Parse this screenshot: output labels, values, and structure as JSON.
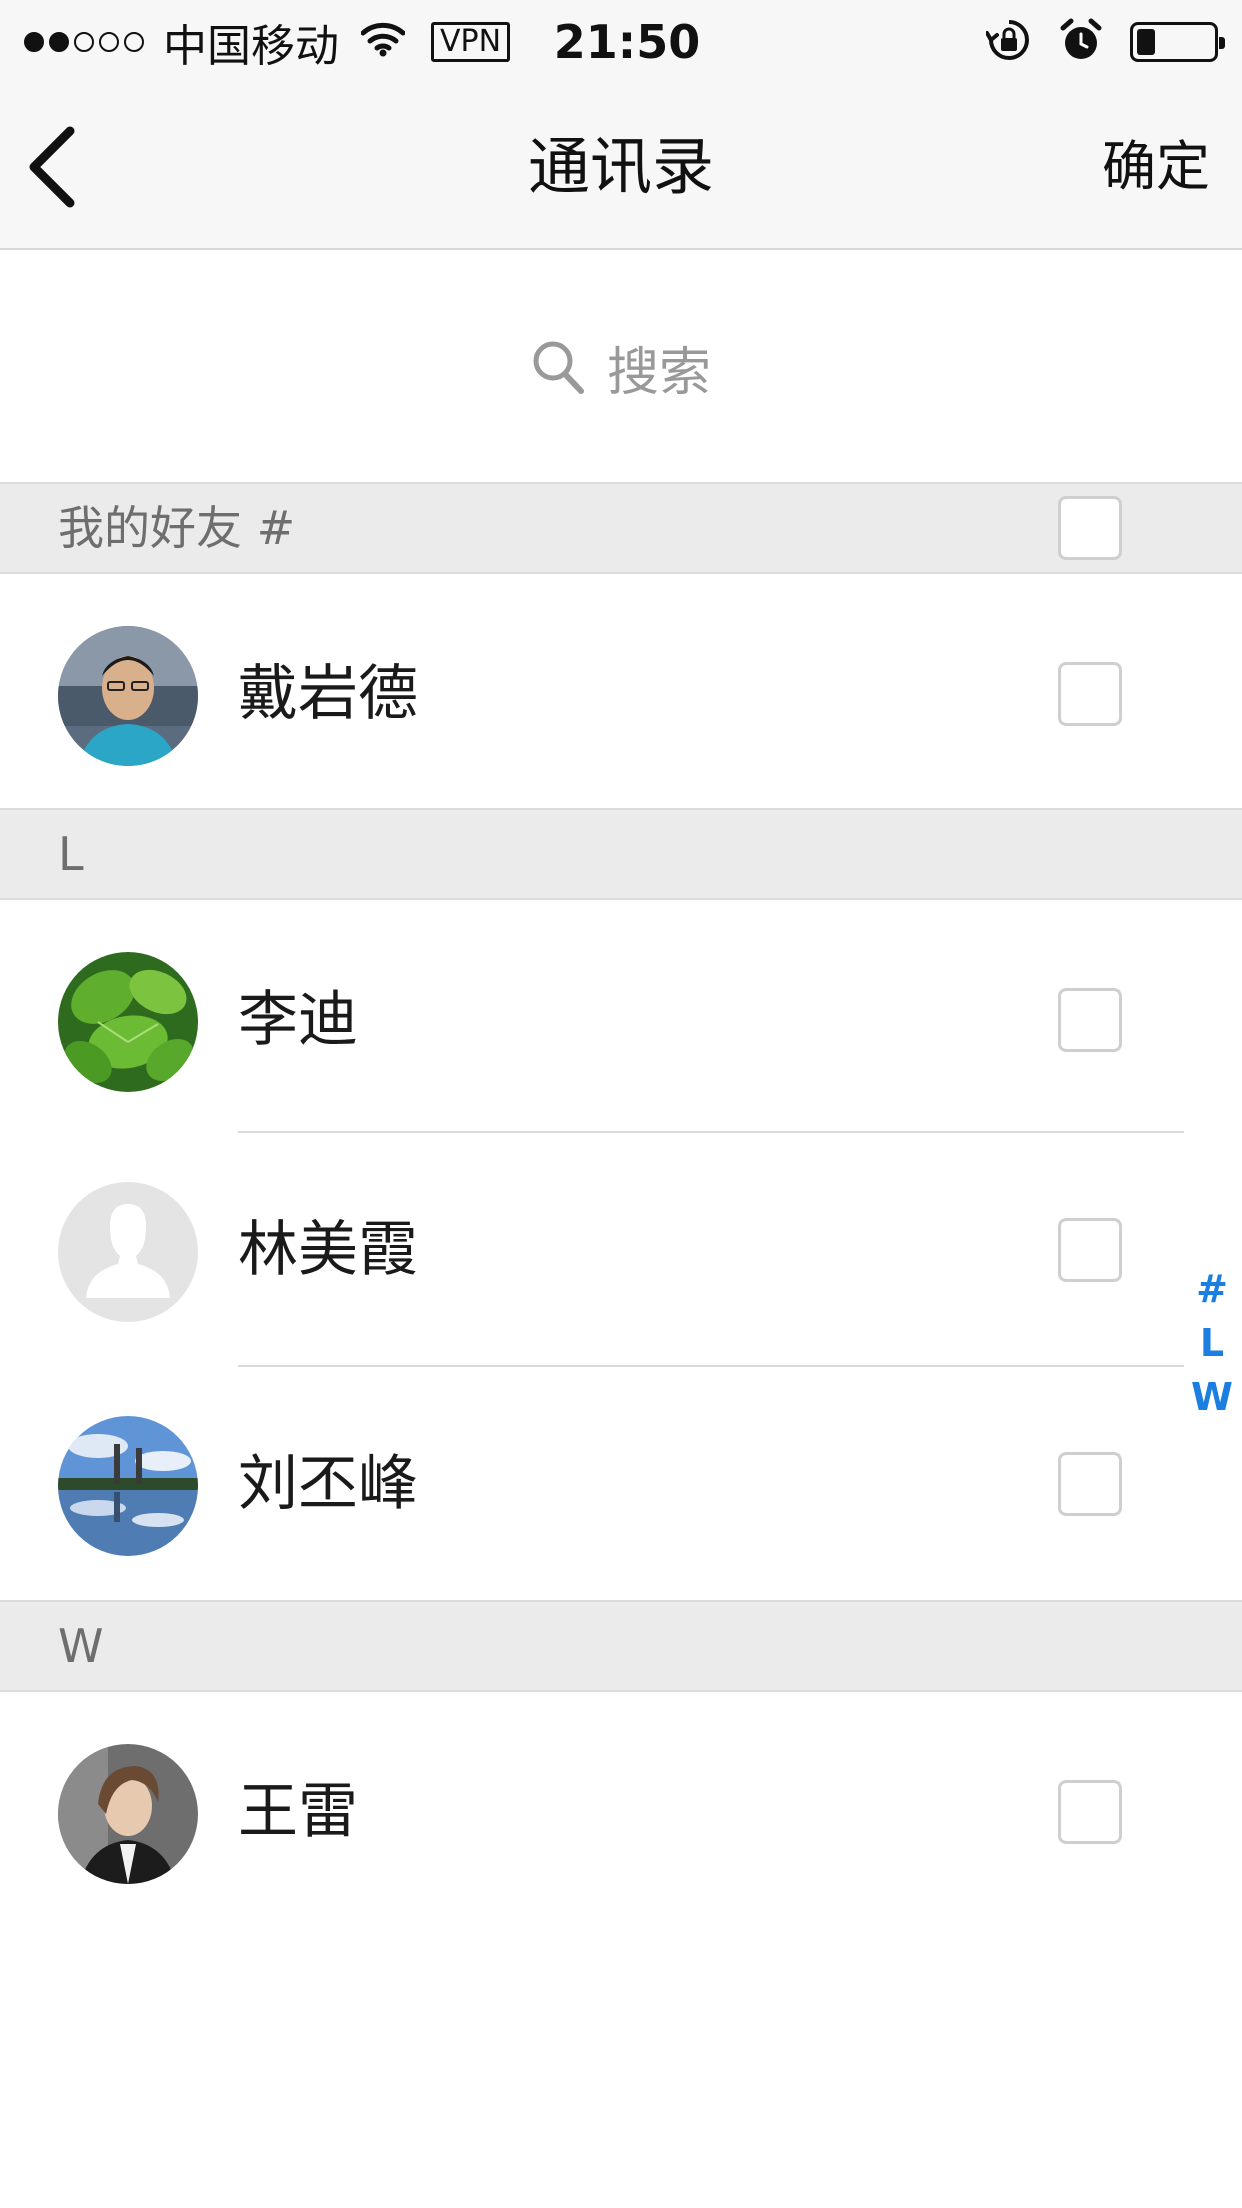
{
  "status_bar": {
    "carrier": "中国移动",
    "vpn": "VPN",
    "time": "21:50",
    "signal_bars_filled": 2,
    "signal_bars_total": 5,
    "battery_level": 0.2
  },
  "nav": {
    "back_icon": "chevron-left-icon",
    "title": "通讯录",
    "confirm_label": "确定"
  },
  "search": {
    "icon": "search-icon",
    "placeholder": "搜索"
  },
  "sections": [
    {
      "title": "我的好友 #",
      "contacts": [
        {
          "name": "戴岩德"
        }
      ]
    },
    {
      "title": "L",
      "contacts": [
        {
          "name": "李迪"
        },
        {
          "name": "林美霞"
        },
        {
          "name": "刘丕峰"
        }
      ]
    },
    {
      "title": "W",
      "contacts": [
        {
          "name": "王雷"
        }
      ]
    }
  ],
  "index_bar": [
    "#",
    "L",
    "W"
  ],
  "colors": {
    "accent": "#1a7fe0",
    "section_bg": "#ebebeb",
    "nav_bg": "#f7f7f7"
  }
}
